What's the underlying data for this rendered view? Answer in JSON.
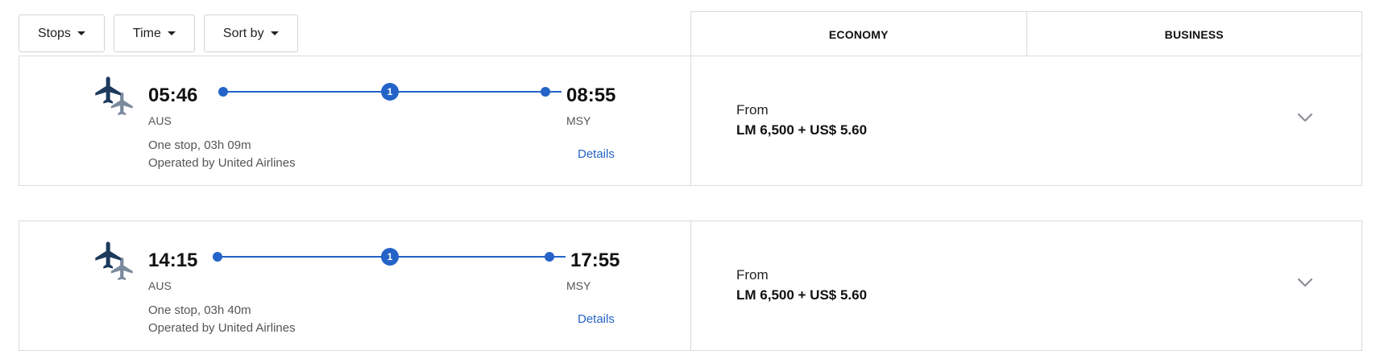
{
  "filters": [
    {
      "label": "Stops"
    },
    {
      "label": "Time"
    },
    {
      "label": "Sort by"
    }
  ],
  "cabins": {
    "economy": "ECONOMY",
    "business": "BUSINESS"
  },
  "flights": [
    {
      "depart_time": "05:46",
      "depart_airport": "AUS",
      "arrive_time": "08:55",
      "arrive_airport": "MSY",
      "stops_count": "1",
      "summary": "One stop, 03h 09m",
      "operator": "Operated by United Airlines",
      "details_label": "Details",
      "price_prefix": "From",
      "price": "LM 6,500 + US$ 5.60"
    },
    {
      "depart_time": "14:15",
      "depart_airport": "AUS",
      "arrive_time": "17:55",
      "arrive_airport": "MSY",
      "stops_count": "1",
      "summary": "One stop, 03h 40m",
      "operator": "Operated by United Airlines",
      "details_label": "Details",
      "price_prefix": "From",
      "price": "LM 6,500 + US$ 5.60"
    }
  ],
  "colors": {
    "accent": "#2463c7",
    "plane_primary": "#1b3a5c",
    "plane_secondary": "#7a8a9c",
    "border": "#d7dade"
  },
  "icons": {
    "filter_caret": "caret-down-icon",
    "plane": "airplane-icon",
    "expand": "chevron-down-icon"
  }
}
